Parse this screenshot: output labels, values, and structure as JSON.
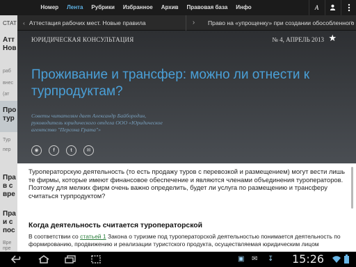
{
  "topnav": {
    "items": [
      {
        "label": "Номер"
      },
      {
        "label": "Лента",
        "active": true
      },
      {
        "label": "Рубрики"
      },
      {
        "label": "Избранное"
      },
      {
        "label": "Архив"
      },
      {
        "label": "Правовая база"
      },
      {
        "label": "Инфо"
      }
    ],
    "font_button": "A",
    "user_icon": "user-icon",
    "menu_icon": "menu-icon",
    "active_color": "#5fb3e6"
  },
  "subbar": {
    "prev_title": "Аттестация рабочих мест. Новые правила",
    "next_title": "Право на «упрощенку» при создании обособленного"
  },
  "leftpanel": {
    "lines": [
      "СТАТ",
      "Атт",
      "Нов",
      "раб",
      "внес",
      "(ат",
      "Про",
      "тур",
      "Тур",
      "пер",
      "Пра",
      "в с",
      "вре",
      "Пра",
      "и с",
      "пос",
      "Вре",
      "пре"
    ]
  },
  "hero": {
    "kicker": "ЮРИДИЧЕСКАЯ КОНСУЛЬТАЦИЯ",
    "issue": "№ 4, АПРЕЛЬ 2013",
    "title": "Проживание и трансфер: можно ли отнести к турпродуктам?",
    "credit": "Советы читателям дает Александр Байбородин, руководитель юридического отдела ООО «Юридическое агентство \"Персона Грата\"»",
    "share_icons": [
      "social-icon",
      "facebook-icon",
      "twitter-icon",
      "email-icon"
    ],
    "title_color": "#4aa0d8"
  },
  "article": {
    "lead": "Туроператорскую деятельность (то есть продажу туров с перевозкой и размещением) могут вести лишь те фирмы, которые имеют финансовое обеспечение и являются членами объединения туроператоров. Поэтому для мелких фирм очень важно определить, будет ли услуга по размещению и трансферу считаться турпродуктом?",
    "heading": "Когда деятельность считается туроператорской",
    "para_before": "В соответствии со ",
    "para_link": "статьей 1",
    "para_after": " Закона о туризме под туроператорской деятельностью понимается деятельность по формированию, продвижению и реализации туристского продукта, осуществляемая юридическим лицом",
    "link_color": "#2a7e3b"
  },
  "sysbar": {
    "clock": "15:26",
    "nav_icons": [
      "back-icon",
      "home-icon",
      "recent-apps-icon",
      "screenshot-icon"
    ],
    "status_icons": [
      "camera-icon",
      "inbox-icon",
      "download-icon",
      "wifi-icon",
      "battery-icon"
    ]
  }
}
